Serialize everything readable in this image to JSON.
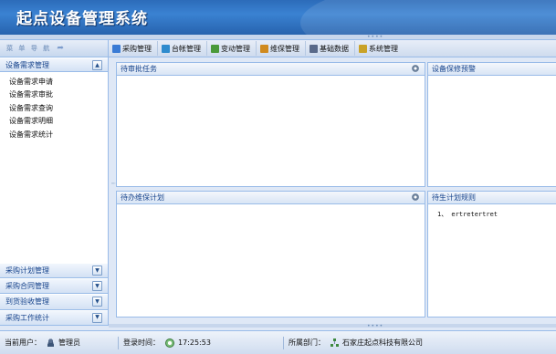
{
  "app": {
    "title": "起点设备管理系统"
  },
  "nav": {
    "header": "菜 单 导 航"
  },
  "sidebar": {
    "active_group": "设备需求管理",
    "items": [
      "设备需求申请",
      "设备需求审批",
      "设备需求查询",
      "设备需求明细",
      "设备需求统计"
    ],
    "collapsed_groups": [
      "采购计划管理",
      "采购合同管理",
      "到货验收管理",
      "采购工作统计"
    ]
  },
  "toolbar": {
    "buttons": [
      {
        "label": "采购管理",
        "icon": "purchase-icon",
        "color": "#3a7bd5"
      },
      {
        "label": "台帐管理",
        "icon": "ledger-icon",
        "color": "#2e8bce"
      },
      {
        "label": "变动管理",
        "icon": "change-icon",
        "color": "#4a9a3a"
      },
      {
        "label": "维保管理",
        "icon": "maintenance-icon",
        "color": "#d08a1e"
      },
      {
        "label": "基础数据",
        "icon": "basedata-icon",
        "color": "#5a6a8a"
      },
      {
        "label": "系统管理",
        "icon": "system-icon",
        "color": "#c9a227"
      }
    ]
  },
  "panels": {
    "pending_approval": {
      "title": "待审批任务"
    },
    "equipment_warning": {
      "title": "设备保修预警"
    },
    "maintenance_plan": {
      "title": "待办维保计划"
    },
    "plan_rules": {
      "title": "待生计划规则",
      "items": [
        "1、 ertretertret"
      ]
    }
  },
  "status": {
    "user_label": "当前用户：",
    "user_value": "管理员",
    "login_label": "登录时间：",
    "login_value": "17:25:53",
    "dept_label": "所属部门：",
    "dept_value": "石家庄起点科技有限公司"
  }
}
